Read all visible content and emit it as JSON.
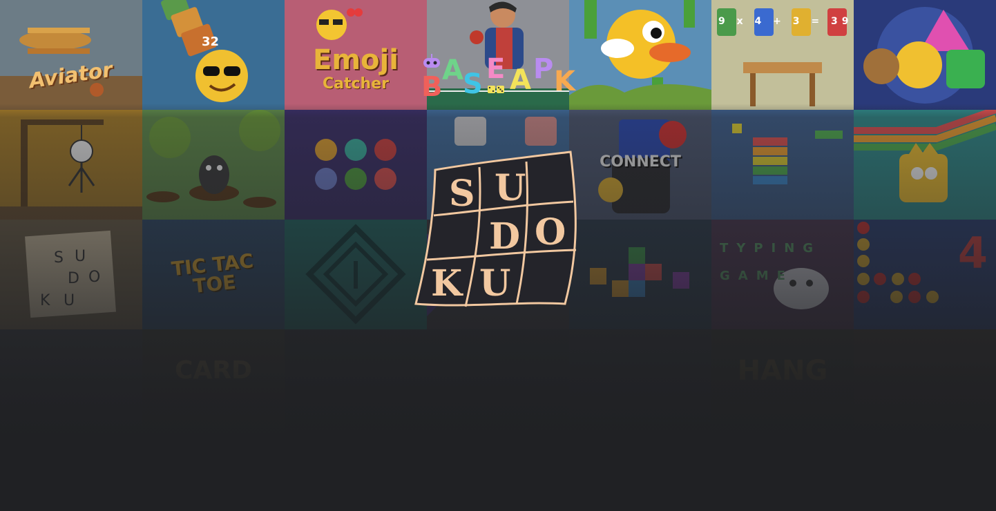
{
  "brand": {
    "logo_letters": [
      "B",
      "A",
      "S",
      "E",
      "A",
      "P",
      "K"
    ],
    "logo_colors": [
      "#f0605a",
      "#6fd38a",
      "#3fc4e6",
      "#f58ac6",
      "#f3e35a",
      "#b98cf0",
      "#f7a950"
    ],
    "controller_color": "#b98cf0",
    "dice_color": "#f3e35a"
  },
  "splash": {
    "letters": [
      "S",
      "U",
      "D",
      "O",
      "K",
      "U"
    ],
    "stroke_color": "#f2c8a0",
    "fill_color": "#24242a"
  },
  "games": [
    {
      "label": "Aviator",
      "bg": "#7a6a52"
    },
    {
      "label": "32",
      "bg": "#3e6f9a"
    },
    {
      "label": "Emoji",
      "sub": "Catcher",
      "bg": "#b46070"
    },
    {
      "label": "",
      "bg": "#8a8a90"
    },
    {
      "label": "",
      "bg": "#4f7fa2"
    },
    {
      "label": "9 x 4 + 3 = 39",
      "bg": "#b9b694"
    },
    {
      "label": "",
      "bg": "#2c3a72"
    },
    {
      "label": "",
      "bg": "#9b7a2c"
    },
    {
      "label": "",
      "bg": "#5c8a4c"
    },
    {
      "label": "",
      "bg": "#3c2f6e"
    },
    {
      "label": "",
      "bg": "#3f6a9a"
    },
    {
      "label": "CONNECT",
      "bg": "#4b5670"
    },
    {
      "label": "",
      "bg": "#3d5d8a"
    },
    {
      "label": "",
      "bg": "#2f8a8a"
    },
    {
      "label": "",
      "bg": "#6e6048"
    },
    {
      "label": "TIC TAC TOE",
      "bg": "#2d4a6a"
    },
    {
      "label": "",
      "bg": "#1f6a66"
    },
    {
      "label": "",
      "bg": "#3a3a40"
    },
    {
      "label": "",
      "bg": "#2b3c4e"
    },
    {
      "label": "TYPING GAME",
      "bg": "#4a3550"
    },
    {
      "label": "4",
      "bg": "#2a3f75"
    },
    {
      "label": "",
      "bg": "#3a3c40"
    },
    {
      "label": "CARD",
      "bg": "#3a3a34"
    },
    {
      "label": "",
      "bg": "#2f3336"
    },
    {
      "label": "",
      "bg": "#2f3336"
    },
    {
      "label": "",
      "bg": "#31343a"
    },
    {
      "label": "HANG",
      "bg": "#34352f"
    },
    {
      "label": "",
      "bg": "#3b3530"
    }
  ]
}
